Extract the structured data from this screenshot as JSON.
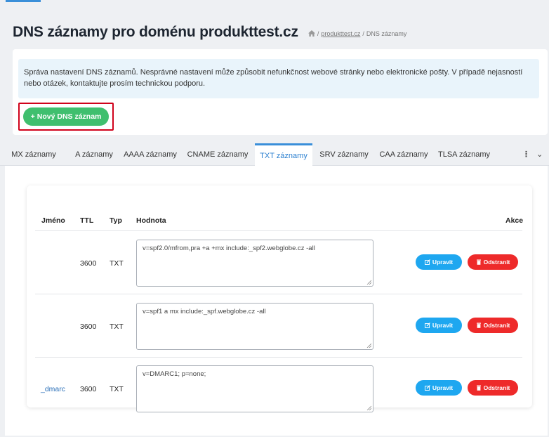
{
  "header": {
    "title": "DNS záznamy pro doménu produkttest.cz",
    "breadcrumb": {
      "sep1": "/",
      "domain_link": "produkttest.cz",
      "sep2": "/",
      "current": "DNS záznamy"
    }
  },
  "info": {
    "text": "Správa nastavení DNS záznamů. Nesprávné nastavení může způsobit nefunkčnost webové stránky nebo elektronické pošty. V případě nejasností nebo otázek, kontaktujte prosím technickou podporu."
  },
  "new_record": {
    "icon": "+",
    "label": "Nový DNS záznam"
  },
  "tabs": [
    {
      "label": "MX záznamy"
    },
    {
      "label": "A záznamy"
    },
    {
      "label": "AAAA záznamy"
    },
    {
      "label": "CNAME záznamy"
    },
    {
      "label": "TXT záznamy"
    },
    {
      "label": "SRV záznamy"
    },
    {
      "label": "CAA záznamy"
    },
    {
      "label": "TLSA záznamy"
    }
  ],
  "active_tab": "TXT záznamy",
  "tabs_more": {
    "dots": "⋮",
    "chevron": "⌄"
  },
  "table": {
    "columns": {
      "name": "Jméno",
      "ttl": "TTL",
      "type": "Typ",
      "value": "Hodnota",
      "actions": "Akce"
    },
    "rows": [
      {
        "name": "",
        "ttl": "3600",
        "type": "TXT",
        "value": "v=spf2.0/mfrom,pra +a +mx include:_spf2.webglobe.cz -all"
      },
      {
        "name": "",
        "ttl": "3600",
        "type": "TXT",
        "value": "v=spf1 a mx include:_spf.webglobe.cz -all"
      },
      {
        "name": "_dmarc",
        "ttl": "3600",
        "type": "TXT",
        "value": "v=DMARC1; p=none;"
      }
    ],
    "edit_label": "Upravit",
    "delete_label": "Odstranit"
  },
  "colors": {
    "accent": "#3a8fd9",
    "new_button": "#3fbf6e",
    "edit_button": "#1ea7f0",
    "delete_button": "#ee2a2a",
    "highlight_border": "#d0021b",
    "info_bg": "#e9f4fb"
  }
}
